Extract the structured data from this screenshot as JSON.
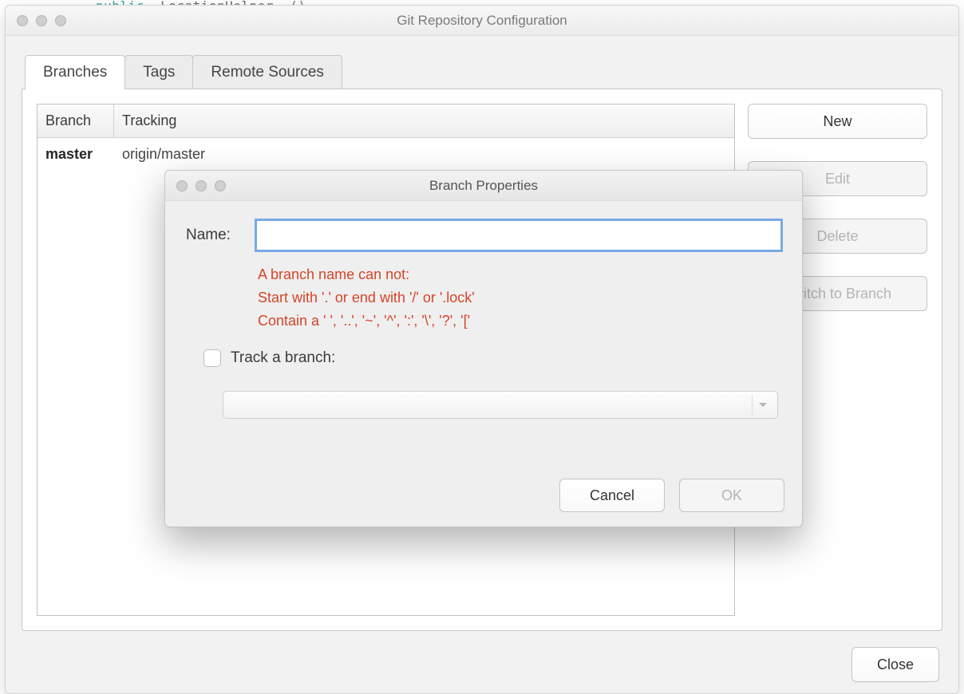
{
  "code_behind": {
    "kw": "public",
    "id": "  LocationHelper  ()"
  },
  "parent": {
    "title": "Git Repository Configuration",
    "tabs": [
      {
        "label": "Branches",
        "active": true
      },
      {
        "label": "Tags",
        "active": false
      },
      {
        "label": "Remote Sources",
        "active": false
      }
    ],
    "table": {
      "headers": {
        "branch": "Branch",
        "tracking": "Tracking"
      },
      "rows": [
        {
          "branch": "master",
          "tracking": "origin/master"
        }
      ]
    },
    "buttons": {
      "new": "New",
      "edit": "Edit",
      "delete": "Delete",
      "switch": "Switch to Branch"
    },
    "close": "Close"
  },
  "modal": {
    "title": "Branch Properties",
    "name_label": "Name:",
    "name_value": "",
    "validation": {
      "line1": "A branch name can not:",
      "line2": "Start with '.' or end with '/' or '.lock'",
      "line3": "Contain a ' ', '..', '~', '^', ':', '\\', '?', '['"
    },
    "track_label": "Track a branch:",
    "track_checked": false,
    "dropdown_value": "",
    "cancel": "Cancel",
    "ok": "OK"
  }
}
